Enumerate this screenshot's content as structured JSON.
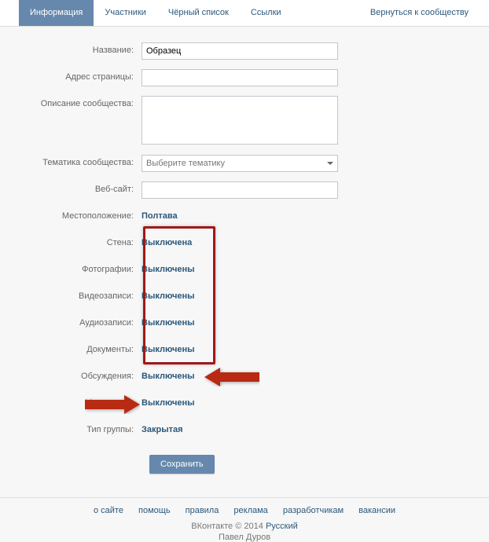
{
  "tabs": {
    "info": "Информация",
    "members": "Участники",
    "blacklist": "Чёрный список",
    "links": "Ссылки",
    "back": "Вернуться к сообществу"
  },
  "labels": {
    "name": "Название:",
    "address": "Адрес страницы:",
    "description": "Описание сообщества:",
    "topic": "Тематика сообщества:",
    "website": "Веб-сайт:",
    "location": "Местоположение:",
    "wall": "Стена:",
    "photos": "Фотографии:",
    "videos": "Видеозаписи:",
    "audios": "Аудиозаписи:",
    "docs": "Документы:",
    "discussions": "Обсуждения:",
    "materials": "Материалы:",
    "grouptype": "Тип группы:"
  },
  "values": {
    "name": "Образец",
    "topic_placeholder": "Выберите тематику",
    "location": "Полтава",
    "wall": "Выключена",
    "photos": "Выключены",
    "videos": "Выключены",
    "audios": "Выключены",
    "docs": "Выключены",
    "discussions": "Выключены",
    "materials": "Выключены",
    "grouptype": "Закрытая"
  },
  "buttons": {
    "save": "Сохранить"
  },
  "footer": {
    "links": [
      "о сайте",
      "помощь",
      "правила",
      "реклама",
      "разработчикам",
      "вакансии"
    ],
    "copyright": "ВКонтакте © 2014",
    "lang": "Русский",
    "author": "Павел Дуров"
  }
}
